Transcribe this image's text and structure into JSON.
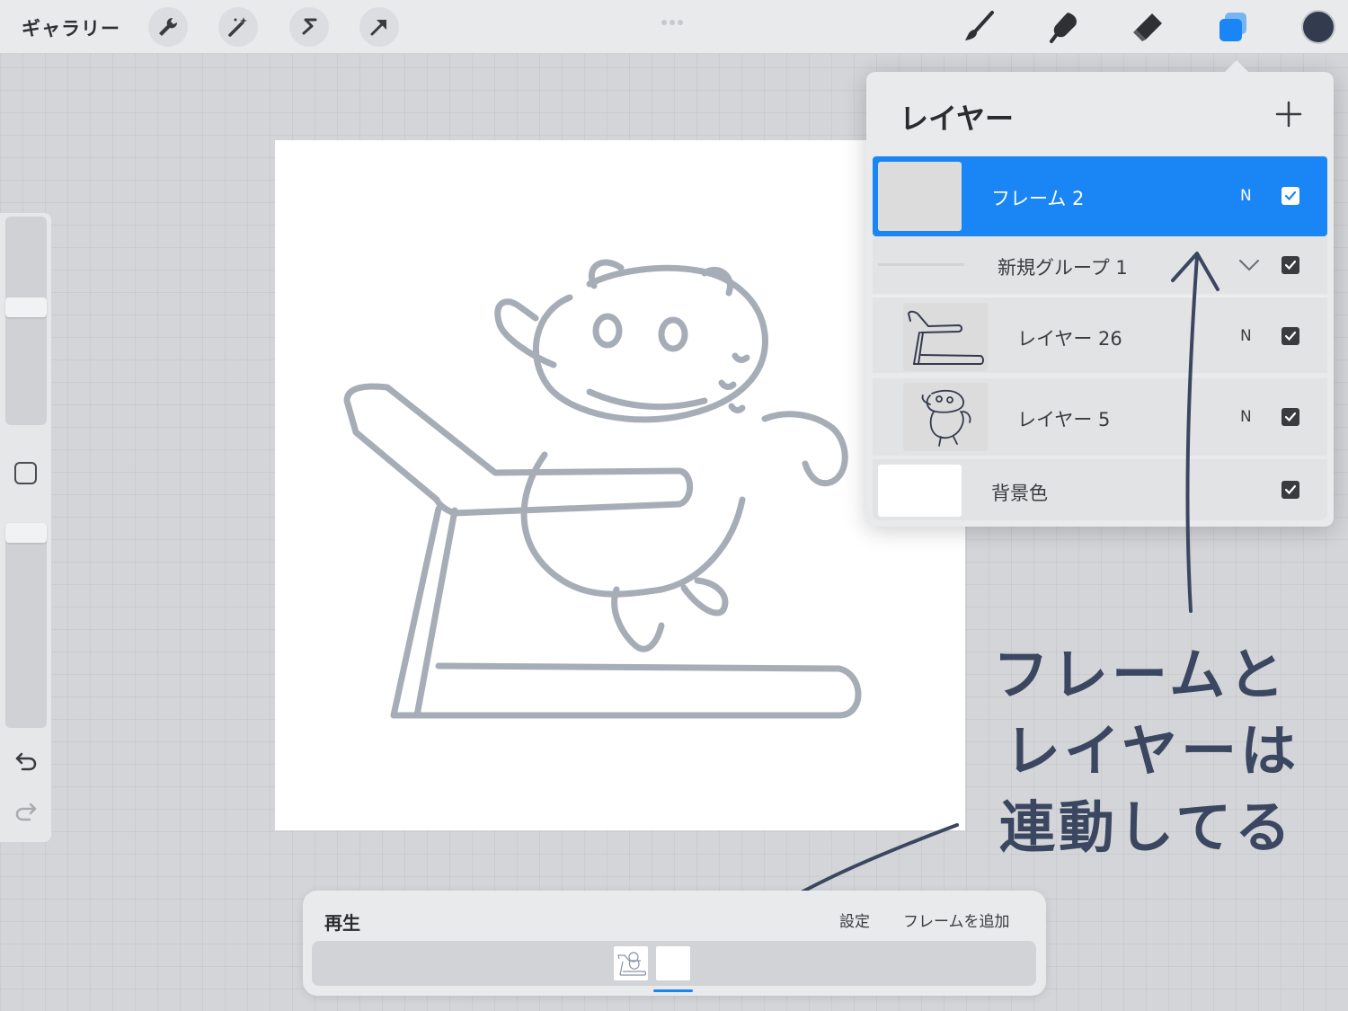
{
  "topbar": {
    "gallery_label": "ギャラリー",
    "tools": [
      "wrench-icon",
      "magic-wand-icon",
      "selection-icon",
      "transform-arrow-icon"
    ],
    "right_tools": [
      "brush-icon",
      "smudge-icon",
      "eraser-icon",
      "layers-icon"
    ],
    "color_swatch": "#333b4e",
    "accent_color": "#1a86f5"
  },
  "sidebar": {
    "icons": [
      "brush-size-slider",
      "modify-square-icon",
      "opacity-slider",
      "undo-icon",
      "redo-icon"
    ]
  },
  "layers_panel": {
    "title": "レイヤー",
    "add_icon": "plus-icon",
    "rows": [
      {
        "name": "フレーム 2",
        "blend": "N",
        "checked": true,
        "active": true
      },
      {
        "name": "新規グループ 1",
        "checked": true,
        "group": true
      },
      {
        "name": "レイヤー 26",
        "blend": "N",
        "checked": true
      },
      {
        "name": "レイヤー 5",
        "blend": "N",
        "checked": true
      },
      {
        "name": "背景色",
        "checked": true
      }
    ]
  },
  "annotation": {
    "line1": "フレームと",
    "line2": "レイヤーは",
    "line3": "連動してる"
  },
  "timeline": {
    "play_label": "再生",
    "settings_label": "設定",
    "add_frame_label": "フレームを追加"
  }
}
